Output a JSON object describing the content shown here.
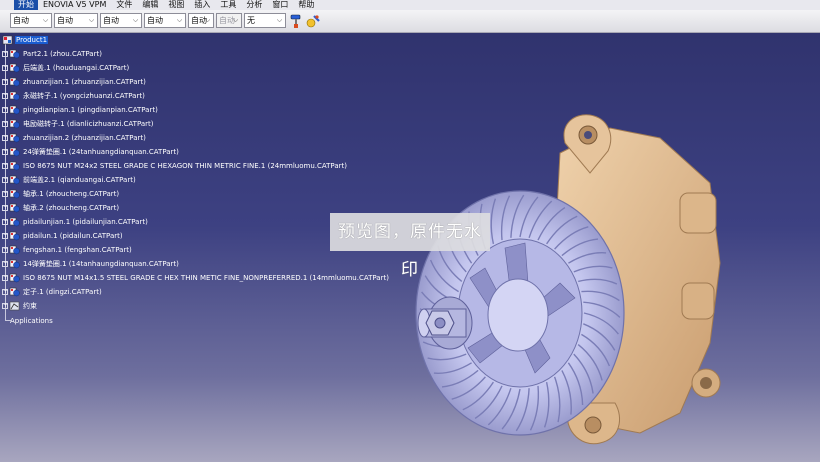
{
  "menu": {
    "start": "开始",
    "items": [
      "ENOVIA V5 VPM",
      "文件",
      "编辑",
      "视图",
      "插入",
      "工具",
      "分析",
      "窗口",
      "帮助"
    ]
  },
  "toolbar": {
    "combos": [
      {
        "value": "自动",
        "enabled": true
      },
      {
        "value": "自动",
        "enabled": true
      },
      {
        "value": "自动",
        "enabled": true
      },
      {
        "value": "自动",
        "enabled": true
      },
      {
        "value": "自动",
        "enabled": true
      },
      {
        "value": "自动",
        "enabled": false
      },
      {
        "value": "无",
        "enabled": true
      }
    ],
    "icons": [
      "format-painter-icon",
      "reset-format-icon"
    ]
  },
  "tree": {
    "root": "Product1",
    "items": [
      "Part2.1 (zhou.CATPart)",
      "后端盖.1 (houduangai.CATPart)",
      "zhuanzijian.1 (zhuanzijian.CATPart)",
      "永磁转子.1 (yongcizhuanzi.CATPart)",
      "pingdianpian.1 (pingdianpian.CATPart)",
      "电励磁转子.1 (dianlicizhuanzi.CATPart)",
      "zhuanzijian.2 (zhuanzijian.CATPart)",
      "24弹簧垫圈.1 (24tanhuangdianquan.CATPart)",
      "ISO 8675 NUT M24x2 STEEL GRADE C HEXAGON THIN METRIC FINE.1 (24mmluomu.CATPart)",
      "前端盖2.1 (qianduangai.CATPart)",
      "轴承.1 (zhoucheng.CATPart)",
      "轴承.2 (zhoucheng.CATPart)",
      "pidailunjian.1 (pidailunjian.CATPart)",
      "pidailun.1 (pidailun.CATPart)",
      "fengshan.1 (fengshan.CATPart)",
      "14弹簧垫圈.1 (14tanhaungdianquan.CATPart)",
      "ISO 8675 NUT M14x1.5 STEEL GRADE C HEX THIN METIC FINE_NONPREFERRED.1 (14mmluomu.CATPart)",
      "定子.1 (dingzi.CATPart)",
      "约束"
    ],
    "footer": "Applications"
  },
  "watermark": "预览图，原件无水印",
  "colors": {
    "background_top": "#30336e",
    "background_bottom": "#a8a6bf",
    "housing": "#e3c19a",
    "fan": "#c9cbef",
    "selection": "#1a5cd0"
  }
}
